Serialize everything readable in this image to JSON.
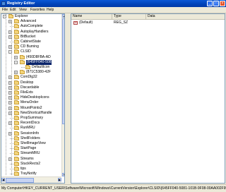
{
  "window": {
    "title": "Registry Editor",
    "minimize": "_",
    "maximize": "□",
    "close": "×"
  },
  "menu": [
    "File",
    "Edit",
    "View",
    "Favorites",
    "Help"
  ],
  "tree": {
    "items": [
      {
        "label": "Explorer",
        "expander": "-"
      },
      {
        "label": "Advanced",
        "expander": "+"
      },
      {
        "label": "AutoComplete",
        "expander": ""
      },
      {
        "label": "AutoplayHandlers",
        "expander": "+"
      },
      {
        "label": "BitBucket",
        "expander": "+"
      },
      {
        "label": "CabinetState",
        "expander": ""
      },
      {
        "label": "CD Burning",
        "expander": "+"
      },
      {
        "label": "CLSID",
        "expander": "-"
      },
      {
        "label": "{450D8FBA-AD",
        "expander": "+"
      },
      {
        "label": "{645FF040-508",
        "expander": "-",
        "selected": true
      },
      {
        "label": "DefaultIcon",
        "expander": ""
      },
      {
        "label": "{871C5380-42F",
        "expander": "+"
      },
      {
        "label": "ComDlg32",
        "expander": "+"
      },
      {
        "label": "Desktop",
        "expander": "+"
      },
      {
        "label": "Discardable",
        "expander": "+"
      },
      {
        "label": "FileExts",
        "expander": "+"
      },
      {
        "label": "HideDesktopIcons",
        "expander": "+"
      },
      {
        "label": "MenuOrder",
        "expander": "+"
      },
      {
        "label": "MountPoints2",
        "expander": "+"
      },
      {
        "label": "NewShortcutHandle",
        "expander": "+"
      },
      {
        "label": "PropSummary",
        "expander": ""
      },
      {
        "label": "RecentDocs",
        "expander": "+"
      },
      {
        "label": "RunMRU",
        "expander": ""
      },
      {
        "label": "SessionInfo",
        "expander": "+"
      },
      {
        "label": "ShellFolders",
        "expander": ""
      },
      {
        "label": "ShellImageView",
        "expander": ""
      },
      {
        "label": "StartPage",
        "expander": ""
      },
      {
        "label": "StreamMRU",
        "expander": ""
      },
      {
        "label": "Streams",
        "expander": "+"
      },
      {
        "label": "StuckRects2",
        "expander": ""
      },
      {
        "label": "tips",
        "expander": ""
      },
      {
        "label": "TrayNotify",
        "expander": ""
      }
    ]
  },
  "list": {
    "columns": [
      "Name",
      "Type",
      "Data"
    ],
    "rows": [
      {
        "name": "(Default)",
        "type": "REG_SZ",
        "data": "",
        "icon": "ab-icon"
      }
    ]
  },
  "status_bar": "My Computer\\HKEY_CURRENT_USER\\Software\\Microsoft\\Windows\\CurrentVersion\\Explorer\\CLSID\\{645FF040-5081-101B-9F08-00AA002F954E}"
}
